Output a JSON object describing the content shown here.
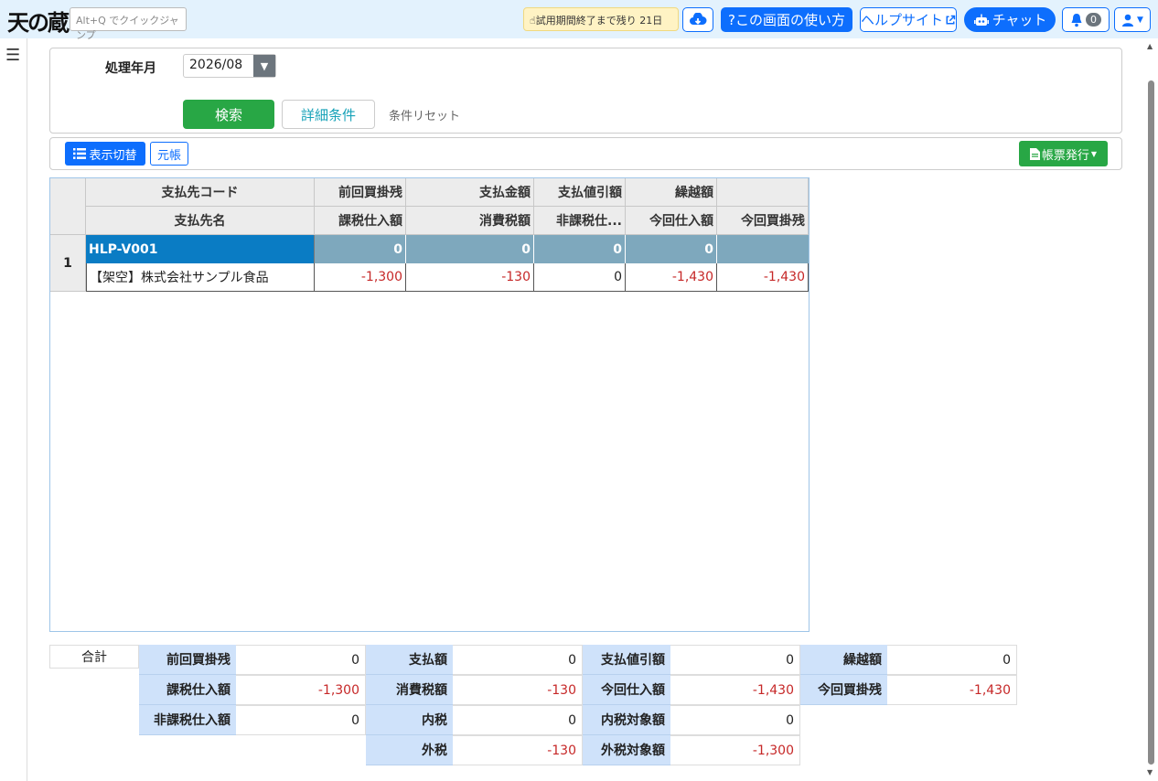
{
  "header": {
    "logo_text": "天の蔵",
    "quick_jump_placeholder": "Alt+Q でクイックジャンプ",
    "trial_text": "試用期間終了まで残り 21日",
    "howto_label": "?この画面の使い方",
    "help_label": "ヘルプサイト",
    "chat_label": "チャット",
    "notification_count": "0"
  },
  "search": {
    "period_label": "処理年月",
    "period_value": "2026/08",
    "search_label": "検索",
    "detail_label": "詳細条件",
    "reset_label": "条件リセット"
  },
  "toolbar": {
    "view_toggle_label": "表示切替",
    "ledger_label": "元帳",
    "report_label": "帳票発行"
  },
  "grid": {
    "header_row1": [
      "支払先コード",
      "前回買掛残",
      "支払金額",
      "支払値引額",
      "繰越額",
      ""
    ],
    "header_row2": [
      "支払先名",
      "課税仕入額",
      "消費税額",
      "非課税仕...",
      "今回仕入額",
      "今回買掛残"
    ],
    "rows": [
      {
        "num": "1",
        "code": "HLP-V001",
        "line1": [
          "0",
          "0",
          "0",
          "0",
          ""
        ],
        "name": "【架空】株式会社サンプル食品",
        "line2": [
          "-1,300",
          "-130",
          "0",
          "-1,430",
          "-1,430"
        ]
      }
    ]
  },
  "totals": {
    "label": "合計",
    "prev_balance_label": "前回買掛残",
    "prev_balance": "0",
    "payment_label": "支払額",
    "payment": "0",
    "discount_label": "支払値引額",
    "discount": "0",
    "carryover_label": "繰越額",
    "carryover": "0",
    "taxable_label": "課税仕入額",
    "taxable": "-1,300",
    "tax_label": "消費税額",
    "tax": "-130",
    "current_purchase_label": "今回仕入額",
    "current_purchase": "-1,430",
    "current_balance_label": "今回買掛残",
    "current_balance": "-1,430",
    "nontaxable_label": "非課税仕入額",
    "nontaxable": "0",
    "inner_tax_label": "内税",
    "inner_tax": "0",
    "inner_tax_target_label": "内税対象額",
    "inner_tax_target": "0",
    "outer_tax_label": "外税",
    "outer_tax": "-130",
    "outer_tax_target_label": "外税対象額",
    "outer_tax_target": "-1,300"
  }
}
